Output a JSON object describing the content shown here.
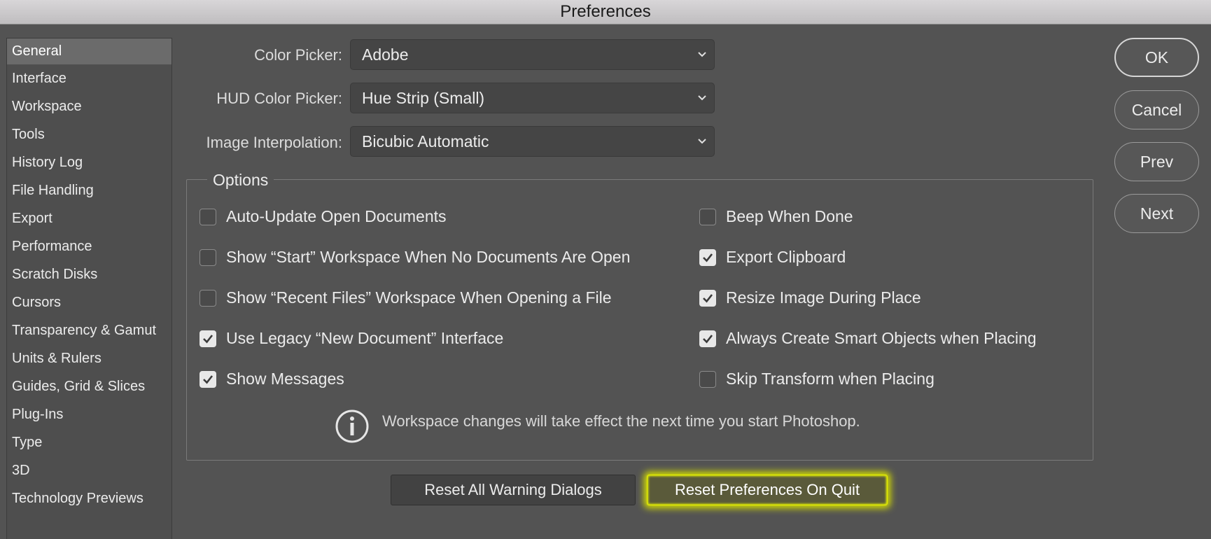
{
  "window": {
    "title": "Preferences"
  },
  "sidebar": {
    "items": [
      {
        "label": "General",
        "selected": true
      },
      {
        "label": "Interface"
      },
      {
        "label": "Workspace"
      },
      {
        "label": "Tools"
      },
      {
        "label": "History Log"
      },
      {
        "label": "File Handling"
      },
      {
        "label": "Export"
      },
      {
        "label": "Performance"
      },
      {
        "label": "Scratch Disks"
      },
      {
        "label": "Cursors"
      },
      {
        "label": "Transparency & Gamut"
      },
      {
        "label": "Units & Rulers"
      },
      {
        "label": "Guides, Grid & Slices"
      },
      {
        "label": "Plug-Ins"
      },
      {
        "label": "Type"
      },
      {
        "label": "3D"
      },
      {
        "label": "Technology Previews"
      }
    ]
  },
  "fields": {
    "color_picker": {
      "label": "Color Picker:",
      "value": "Adobe"
    },
    "hud_color_picker": {
      "label": "HUD Color Picker:",
      "value": "Hue Strip (Small)"
    },
    "image_interpolation": {
      "label": "Image Interpolation:",
      "value": "Bicubic Automatic"
    }
  },
  "options": {
    "title": "Options",
    "left": [
      {
        "label": "Auto-Update Open Documents",
        "checked": false
      },
      {
        "label": "Show “Start” Workspace When No Documents Are Open",
        "checked": false
      },
      {
        "label": "Show “Recent Files” Workspace When Opening a File",
        "checked": false
      },
      {
        "label": "Use Legacy “New Document” Interface",
        "checked": true
      },
      {
        "label": "Show Messages",
        "checked": true
      }
    ],
    "right": [
      {
        "label": "Beep When Done",
        "checked": false
      },
      {
        "label": "Export Clipboard",
        "checked": true
      },
      {
        "label": "Resize Image During Place",
        "checked": true
      },
      {
        "label": "Always Create Smart Objects when Placing",
        "checked": true
      },
      {
        "label": "Skip Transform when Placing",
        "checked": false
      }
    ],
    "info_text": "Workspace changes will take effect the next time you start Photoshop."
  },
  "bottom_buttons": {
    "reset_warnings": "Reset All Warning Dialogs",
    "reset_prefs": "Reset Preferences On Quit"
  },
  "side_buttons": {
    "ok": "OK",
    "cancel": "Cancel",
    "prev": "Prev",
    "next": "Next"
  },
  "colors": {
    "background": "#535353",
    "highlight": "#e8f200"
  },
  "icons": {
    "select_arrow": "chevron-down-icon",
    "checkbox": "checkmark-icon",
    "info": "info-icon"
  }
}
